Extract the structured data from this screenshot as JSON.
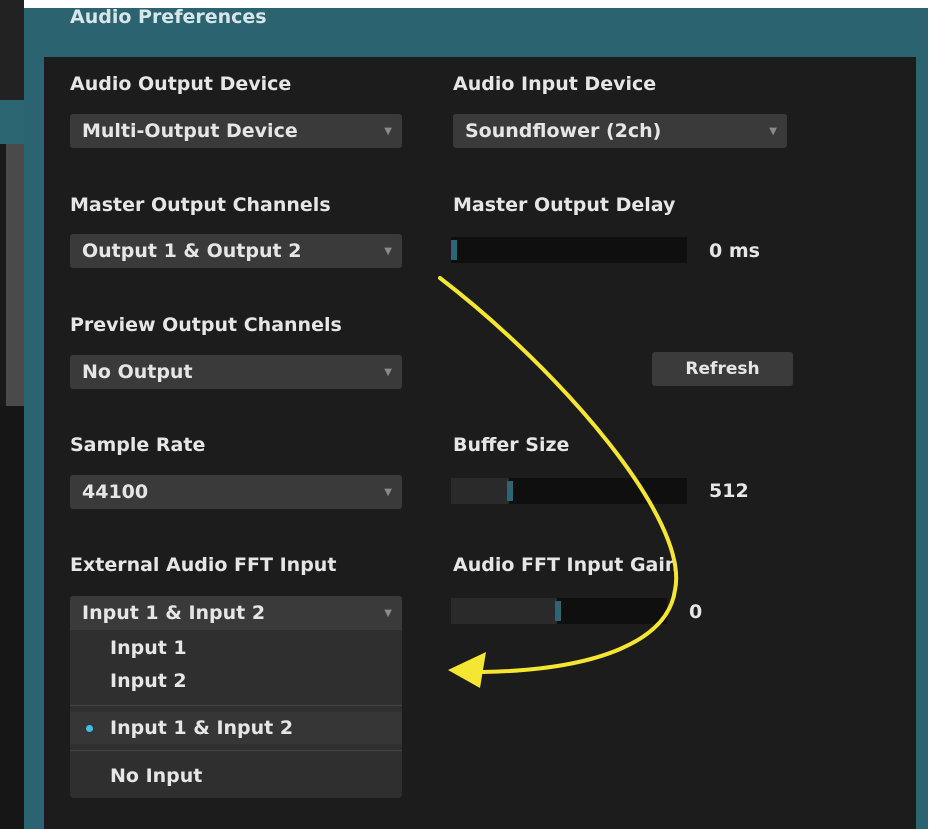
{
  "window": {
    "title": "Audio Preferences"
  },
  "output_device": {
    "label": "Audio Output Device",
    "value": "Multi-Output Device"
  },
  "input_device": {
    "label": "Audio Input Device",
    "value": "Soundflower (2ch)"
  },
  "master_channels": {
    "label": "Master Output Channels",
    "value": "Output 1 & Output 2"
  },
  "master_delay": {
    "label": "Master Output Delay",
    "value": "0 ms",
    "level": 0.0
  },
  "preview_channels": {
    "label": "Preview Output Channels",
    "value": "No Output"
  },
  "refresh": {
    "label": "Refresh"
  },
  "sample_rate": {
    "label": "Sample Rate",
    "value": "44100"
  },
  "buffer_size": {
    "label": "Buffer Size",
    "value": "512",
    "level": 0.25
  },
  "fft_input": {
    "label": "External Audio FFT Input",
    "value": "Input 1 & Input 2",
    "options": [
      "Input 1",
      "Input 2",
      "Input 1 & Input 2",
      "No Input"
    ],
    "selected_index": 2
  },
  "fft_gain": {
    "label": "Audio FFT Input Gain",
    "value": "0",
    "level": 0.5
  },
  "colors": {
    "accent": "#2d6673",
    "annotation": "#f5e632",
    "bullet": "#3cc1e6",
    "panel": "#1c1c1c"
  },
  "icons": {
    "dropdown": "chevron-down-icon",
    "annotation": "curved-arrow-icon"
  }
}
